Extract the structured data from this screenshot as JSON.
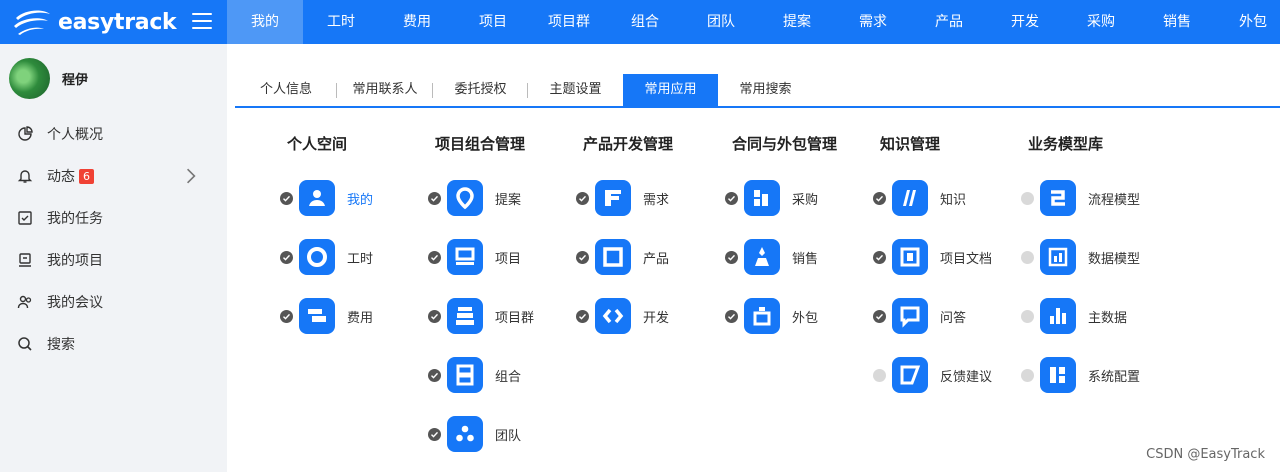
{
  "brand": {
    "name": "easytrack"
  },
  "nav": {
    "items": [
      "我的",
      "工时",
      "费用",
      "项目",
      "项目群",
      "组合",
      "团队",
      "提案",
      "需求",
      "产品",
      "开发",
      "采购",
      "销售",
      "外包"
    ],
    "active_index": 0
  },
  "user": {
    "name": "程伊"
  },
  "sidebar": {
    "items": [
      {
        "label": "个人概况",
        "icon": "pie-chart-icon"
      },
      {
        "label": "动态",
        "icon": "bell-icon",
        "badge": "6"
      },
      {
        "label": "我的任务",
        "icon": "task-check-icon"
      },
      {
        "label": "我的项目",
        "icon": "project-icon"
      },
      {
        "label": "我的会议",
        "icon": "meeting-icon"
      },
      {
        "label": "搜索",
        "icon": "search-icon"
      }
    ]
  },
  "tabs": {
    "items": [
      "个人信息",
      "常用联系人",
      "委托授权",
      "主题设置",
      "常用应用",
      "常用搜索"
    ],
    "active_index": 4
  },
  "columns": [
    {
      "title": "个人空间",
      "apps": [
        {
          "label": "我的",
          "checked": true,
          "icon": "user-icon"
        },
        {
          "label": "工时",
          "checked": true,
          "icon": "clock-ring-icon"
        },
        {
          "label": "费用",
          "checked": true,
          "icon": "expense-icon"
        }
      ]
    },
    {
      "title": "项目组合管理",
      "apps": [
        {
          "label": "提案",
          "checked": true,
          "icon": "proposal-icon"
        },
        {
          "label": "项目",
          "checked": true,
          "icon": "project-icon"
        },
        {
          "label": "项目群",
          "checked": true,
          "icon": "program-icon"
        },
        {
          "label": "组合",
          "checked": true,
          "icon": "portfolio-icon"
        },
        {
          "label": "团队",
          "checked": true,
          "icon": "team-icon"
        }
      ]
    },
    {
      "title": "产品开发管理",
      "apps": [
        {
          "label": "需求",
          "checked": true,
          "icon": "requirement-icon"
        },
        {
          "label": "产品",
          "checked": true,
          "icon": "product-icon"
        },
        {
          "label": "开发",
          "checked": true,
          "icon": "code-icon"
        }
      ]
    },
    {
      "title": "合同与外包管理",
      "apps": [
        {
          "label": "采购",
          "checked": true,
          "icon": "purchase-icon"
        },
        {
          "label": "销售",
          "checked": true,
          "icon": "sales-icon"
        },
        {
          "label": "外包",
          "checked": true,
          "icon": "outsource-icon"
        }
      ]
    },
    {
      "title": "知识管理",
      "apps": [
        {
          "label": "知识",
          "checked": true,
          "icon": "knowledge-icon"
        },
        {
          "label": "项目文档",
          "checked": true,
          "icon": "document-icon"
        },
        {
          "label": "问答",
          "checked": true,
          "icon": "qa-icon"
        },
        {
          "label": "反馈建议",
          "checked": false,
          "icon": "feedback-icon"
        }
      ]
    },
    {
      "title": "业务模型库",
      "apps": [
        {
          "label": "流程模型",
          "checked": false,
          "icon": "process-model-icon"
        },
        {
          "label": "数据模型",
          "checked": false,
          "icon": "data-model-icon"
        },
        {
          "label": "主数据",
          "checked": false,
          "icon": "master-data-icon"
        },
        {
          "label": "系统配置",
          "checked": false,
          "icon": "system-config-icon"
        }
      ]
    }
  ],
  "watermark": "CSDN @EasyTrack",
  "colors": {
    "primary": "#1677f7",
    "nav_active": "#4e98f6",
    "sidebar_bg": "#f1f3f6",
    "badge": "#f04134"
  }
}
